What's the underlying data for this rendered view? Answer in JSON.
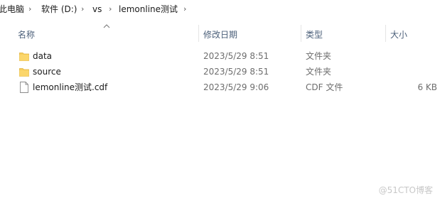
{
  "breadcrumb": {
    "items": [
      "此电脑",
      "软件 (D:)",
      "vs",
      "lemonline测试"
    ],
    "separator": "›"
  },
  "columns": {
    "name": "名称",
    "modified": "修改日期",
    "type": "类型",
    "size": "大小"
  },
  "files": [
    {
      "icon": "folder-icon",
      "name": "data",
      "modified": "2023/5/29 8:51",
      "type": "文件夹",
      "size": ""
    },
    {
      "icon": "folder-icon",
      "name": "source",
      "modified": "2023/5/29 8:51",
      "type": "文件夹",
      "size": ""
    },
    {
      "icon": "file-icon",
      "name": "lemonline测试.cdf",
      "modified": "2023/5/29 9:06",
      "type": "CDF 文件",
      "size": "6 KB"
    }
  ],
  "watermark": "@51CTO博客",
  "colors": {
    "folder": "#f7cd5b",
    "header_text": "#4c607a"
  }
}
